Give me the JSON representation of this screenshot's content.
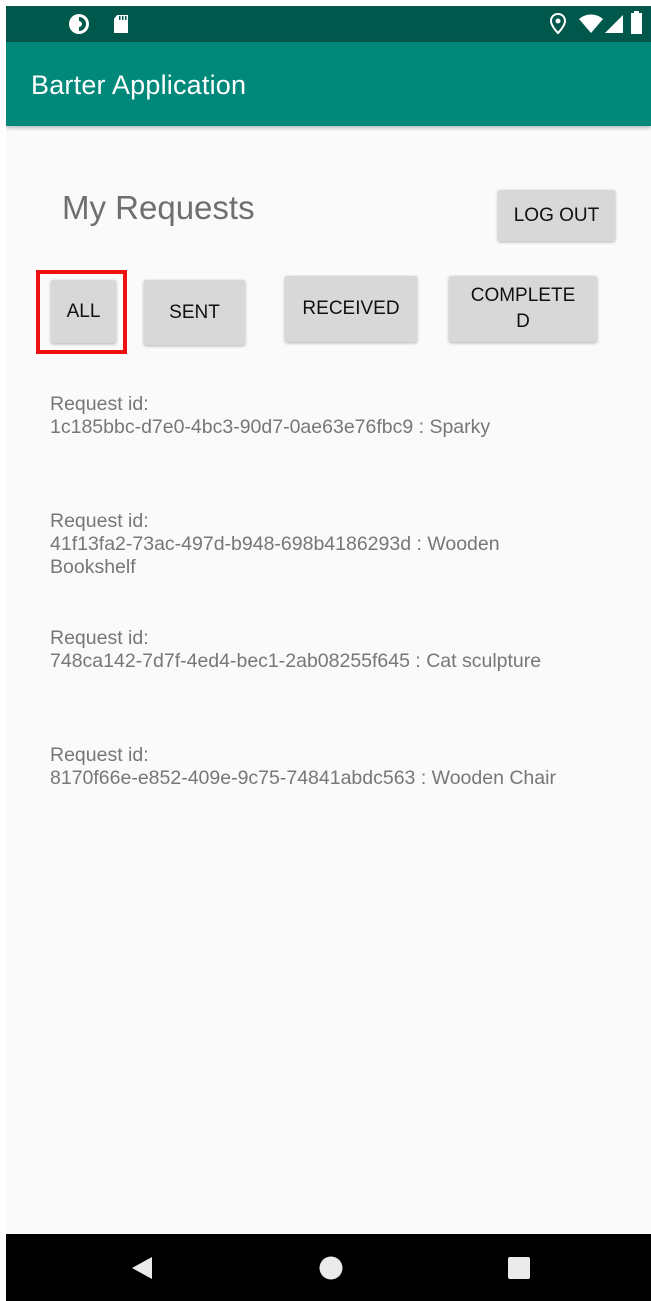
{
  "app_bar": {
    "title": "Barter Application"
  },
  "page": {
    "title": "My Requests",
    "logout_label": "LOG OUT"
  },
  "filters": [
    {
      "label": "ALL",
      "selected": true
    },
    {
      "label": "SENT",
      "selected": false
    },
    {
      "label": "RECEIVED",
      "selected": false
    },
    {
      "label": "COMPLETE\nD",
      "selected": false
    }
  ],
  "requests": [
    {
      "line1": "Request id:",
      "line2": "1c185bbc-d7e0-4bc3-90d7-0ae63e76fbc9 : Sparky"
    },
    {
      "line1": "Request id:",
      "line2": "41f13fa2-73ac-497d-b948-698b4186293d : Wooden Bookshelf"
    },
    {
      "line1": "Request id:",
      "line2": "748ca142-7d7f-4ed4-bec1-2ab08255f645 : Cat sculpture"
    },
    {
      "line1": "Request id:",
      "line2": "8170f66e-e852-409e-9c75-74841abdc563 : Wooden Chair"
    }
  ],
  "icons": {
    "status_left": [
      "app-notification-icon",
      "sd-card-icon"
    ],
    "status_right": [
      "location-icon",
      "wifi-icon",
      "cell-signal-icon",
      "battery-icon"
    ],
    "nav": [
      "back-icon",
      "home-icon",
      "recents-icon"
    ]
  },
  "colors": {
    "status_bar": "#00574b",
    "app_bar": "#00897b",
    "highlight": "#ee1111",
    "button": "#d8d8d8"
  }
}
